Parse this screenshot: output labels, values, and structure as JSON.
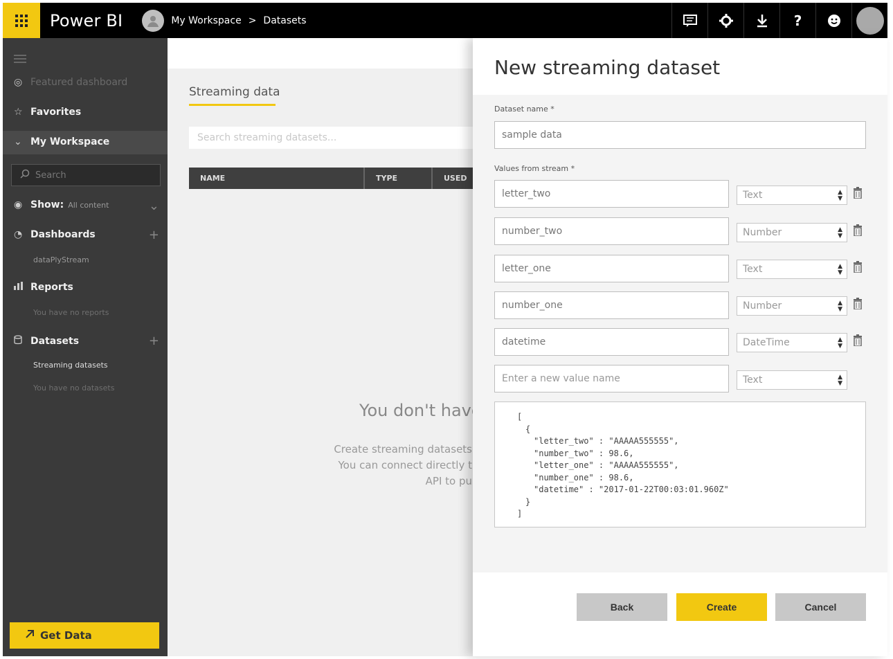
{
  "topbar": {
    "brand": "Power BI",
    "breadcrumb": [
      "My Workspace",
      "Datasets"
    ],
    "breadcrumb_sep": ">"
  },
  "sidebar": {
    "featured": "Featured dashboard",
    "favorites": "Favorites",
    "my_workspace": "My Workspace",
    "search_placeholder": "Search",
    "show_label": "Show:",
    "show_value": "All content",
    "dashboards": "Dashboards",
    "dashboards_sub": "dataPlyStream",
    "reports": "Reports",
    "reports_sub": "You have no reports",
    "datasets": "Datasets",
    "datasets_sub1": "Streaming datasets",
    "datasets_sub2": "You have no datasets",
    "get_data": "Get Data"
  },
  "main": {
    "section_title": "Streaming data",
    "search_placeholder": "Search streaming datasets...",
    "columns": [
      "NAME",
      "TYPE",
      "USED"
    ],
    "empty_title": "You don't have",
    "empty_line1": "Create streaming datasets",
    "empty_line2": "You can connect directly t",
    "empty_line3": "API to pu"
  },
  "panel": {
    "title": "New streaming dataset",
    "name_label": "Dataset name *",
    "name_value": "sample data",
    "values_label": "Values from stream *",
    "rows": [
      {
        "name": "letter_two",
        "type": "Text"
      },
      {
        "name": "number_two",
        "type": "Number"
      },
      {
        "name": "letter_one",
        "type": "Text"
      },
      {
        "name": "number_one",
        "type": "Number"
      },
      {
        "name": "datetime",
        "type": "DateTime"
      }
    ],
    "new_value_placeholder": "Enter a new value name",
    "new_value_type": "Text",
    "json_lines": [
      "[",
      "{",
      "\"letter_two\" : \"AAAAA555555\",",
      "\"number_two\" : 98.6,",
      "\"letter_one\" : \"AAAAA555555\",",
      "\"number_one\" : 98.6,",
      "\"datetime\" : \"2017-01-22T00:03:01.960Z\"",
      "}",
      "]"
    ],
    "back": "Back",
    "create": "Create",
    "cancel": "Cancel"
  },
  "colors": {
    "accent": "#f2c811",
    "sidebar": "#3a3a3a",
    "topbar": "#000000"
  }
}
